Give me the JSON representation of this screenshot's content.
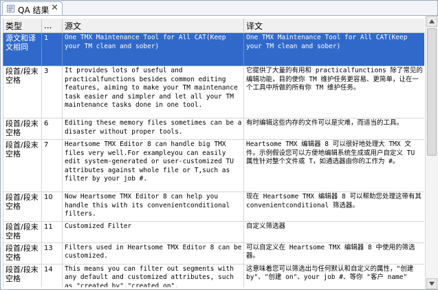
{
  "tab": {
    "label": "QA 结果",
    "close": "✕"
  },
  "columns": [
    "类型",
    "...",
    "源文",
    "译文"
  ],
  "rows": [
    {
      "type": "源文和译文相同",
      "num": "1",
      "source": "One TMX Maintenance Tool for All CAT(Keep your TM clean and sober)",
      "target": "One TMX Maintenance Tool for All CAT(Keep your TM clean and sober)",
      "selected": true
    },
    {
      "type": "段首/段末空格",
      "num": "3",
      "source": " It provides lots of useful and practicalfunctions besides common editing features, aiming to make your TM maintenance task easier and simpler and let all your TM maintenance tasks done in one tool.",
      "target": "它提供了大量的有用和 practicalfunctions 除了常见的编辑功能，目的使你 TM 维护任务更容易、更简单，让在一个工具中所做的所有你 TM 维护任务。",
      "selected": false
    },
    {
      "type": "段首/段末空格",
      "num": "6",
      "source": " Editing these memory files sometimes can be a disaster without proper tools.",
      "target": "有时编辑这些内存的文件可以是灾难，而适当的工具。",
      "selected": false
    },
    {
      "type": "段首/段末空格",
      "num": "7",
      "source": " Heartsome TMX Editor 8 can handle big TMX files very well.For exampleyou can easily edit system-generated or user-customized TU attributes against whole file or T,such as filter by your job #.",
      "target": "Heartsome TMX 编辑器 8 可以很好地处理大 TMX 文件。示例假设您可以方便地编辑系统生成或用户自定义 TU 属性针对整个文件或 T，如通选器由你的工作为 #。",
      "selected": false
    },
    {
      "type": "段首/段末空格",
      "num": "10",
      "source": " Now Heartsome TMX Editor 8 can help you handle this with its convenientconditional filters.",
      "target": "现在 Heartsome TMX 编辑器 8 可以帮助您处理这带有其 convenientconditional 筛选器。",
      "selected": false
    },
    {
      "type": "段首/段末空格",
      "num": "11",
      "source": "Customized Filter",
      "target": "自定义筛选器",
      "selected": false
    },
    {
      "type": "段首/段末空格",
      "num": "13",
      "source": " Filters used in Heartsome TMX Editor 8 can be customized.",
      "target": "可以自定义在 Heartsome TMX 编辑器 8 中使用的筛选器。",
      "selected": false
    },
    {
      "type": "段首/段末空格",
      "num": "14",
      "source": " This means you can filter out segments with any default and customized attributes, such as \"created by\",\"created on\",",
      "target": "这意味着您可以筛选出与任何默认和自定义的属性，\"创建 by\"、\"创建 on\"、your job #、等你 \"客户 name\"",
      "selected": false
    }
  ],
  "colors": {
    "selection": "#3069c9",
    "header_bg": "#f0f0f0"
  }
}
